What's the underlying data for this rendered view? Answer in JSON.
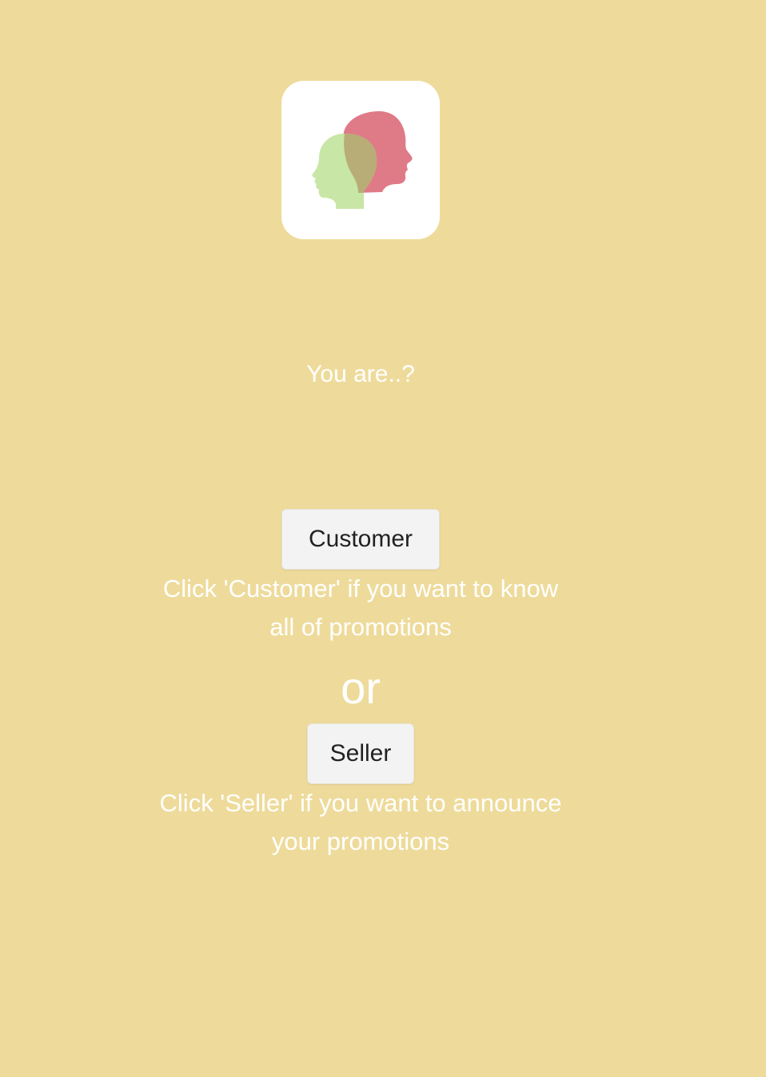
{
  "logo": {
    "icon": "two-heads-icon",
    "colors": {
      "card": "#ffffff",
      "back_head": "#df7a87",
      "front_head": "#c8e6a5",
      "overlap": "#b8ad76"
    }
  },
  "prompt": {
    "question": "You are..?"
  },
  "customer": {
    "button_label": "Customer",
    "hint_line1": "Click 'Customer' if you want to know",
    "hint_line2": "all of promotions"
  },
  "separator": {
    "text": "or"
  },
  "seller": {
    "button_label": "Seller",
    "hint_line1": "Click 'Seller' if you want to announce",
    "hint_line2": "your promotions"
  },
  "theme": {
    "background": "#eedb9b",
    "text": "#ffffff",
    "button_background": "#f3f3f3",
    "button_text": "#222222"
  }
}
